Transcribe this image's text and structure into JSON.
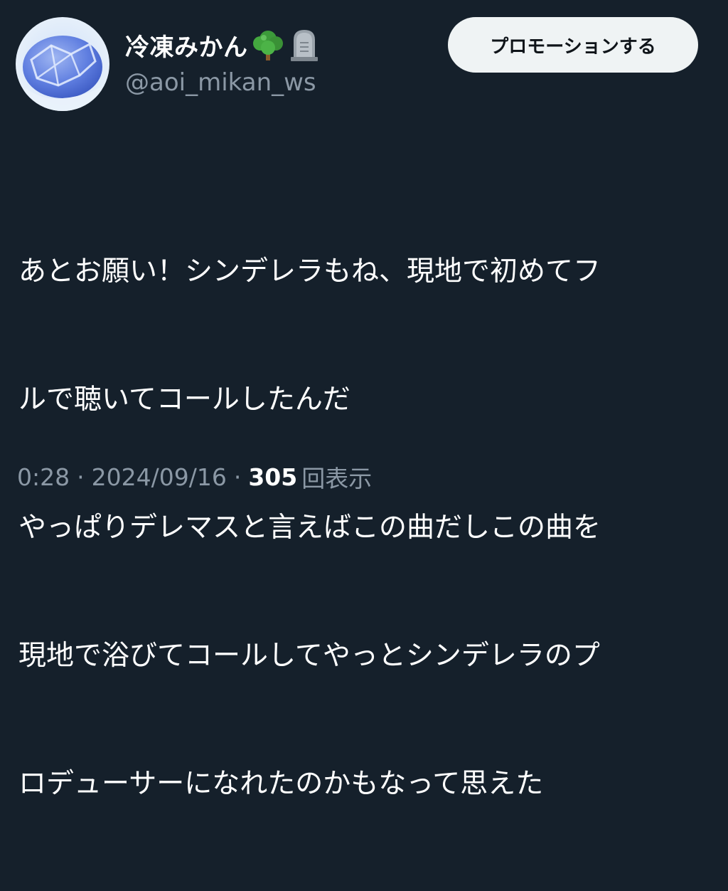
{
  "author": {
    "display_name": "冷凍みかん",
    "handle": "@aoi_mikan_ws",
    "name_emojis": [
      "tree-emoji",
      "tombstone-emoji"
    ]
  },
  "actions": {
    "promote_label": "プロモーションする"
  },
  "tweet": {
    "lines": [
      "あとお願い！シンデレラもね、現地で初めてフ",
      "ルで聴いてコールしたんだ",
      "やっぱりデレマスと言えばこの曲だしこの曲を",
      "現地で浴びてコールしてやっとシンデレラのプ",
      "ロデューサーになれたのかもなって思えた"
    ]
  },
  "meta": {
    "time": "0:28",
    "separator": "·",
    "date": "2024/09/16",
    "views_count": "305",
    "views_label": "回表示"
  },
  "colors": {
    "background": "#15202b",
    "text_primary": "#ffffff",
    "text_secondary": "#8b98a5",
    "button_bg": "#eff3f4",
    "button_text": "#0f1419"
  }
}
